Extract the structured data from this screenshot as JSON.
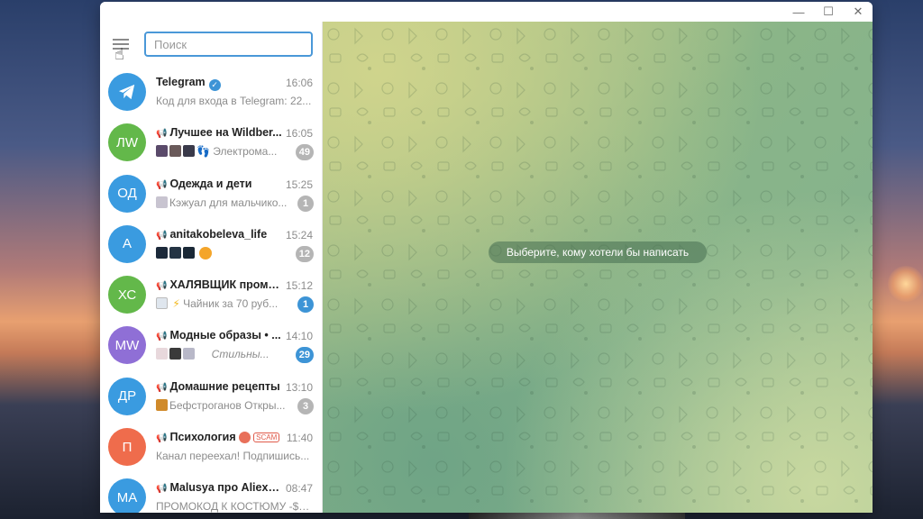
{
  "window": {
    "controls": {
      "minimize": "—",
      "maximize": "☐",
      "close": "✕"
    }
  },
  "sidebar": {
    "search": {
      "placeholder": "Поиск",
      "value": ""
    },
    "chats": [
      {
        "avatar_text": "",
        "avatar_color": "#3a9be0",
        "name": "Telegram",
        "verified": true,
        "time": "16:06",
        "preview": "Код для входа в Telegram: 22...",
        "badge": ""
      },
      {
        "avatar_text": "ЛW",
        "avatar_color": "#63b84a",
        "name": "Лучшее на Wildber...",
        "channel": true,
        "time": "16:05",
        "preview": "Электрома...",
        "badge": "49",
        "badge_style": "muted"
      },
      {
        "avatar_text": "ОД",
        "avatar_color": "#3a9be0",
        "name": "Одежда и дети",
        "channel": true,
        "time": "15:25",
        "preview": "Кэжуал для мальчико...",
        "badge": "1",
        "badge_style": "muted"
      },
      {
        "avatar_text": "А",
        "avatar_color": "#3a9be0",
        "name": "anitakobeleva_life",
        "channel": true,
        "time": "15:24",
        "preview": "",
        "badge": "12",
        "badge_style": "muted"
      },
      {
        "avatar_text": "ХС",
        "avatar_color": "#63b84a",
        "name": "ХАЛЯВЩИК промо...",
        "channel": true,
        "time": "15:12",
        "preview": "Чайник за 70 руб...",
        "badge": "1",
        "badge_style": "blue"
      },
      {
        "avatar_text": "MW",
        "avatar_color": "#8f6fd6",
        "name": "Модные образы • ...",
        "channel": true,
        "time": "14:10",
        "preview": "Стильны...",
        "badge": "29",
        "badge_style": "blue"
      },
      {
        "avatar_text": "ДР",
        "avatar_color": "#3a9be0",
        "name": "Домашние рецепты",
        "channel": true,
        "time": "13:10",
        "preview": "Бефстроганов  Откры...",
        "badge": "3",
        "badge_style": "muted"
      },
      {
        "avatar_text": "П",
        "avatar_color": "#ef6c4c",
        "name": "Психология",
        "channel": true,
        "scam": "SCAM",
        "time": "11:40",
        "preview": "Канал переехал! Подпишись...",
        "badge": ""
      },
      {
        "avatar_text": "MA",
        "avatar_color": "#3a9be0",
        "name": "Malusya про Aliexp...",
        "channel": true,
        "time": "08:47",
        "preview": "ПРОМОКОД К КОСТЮМУ -$3:...",
        "badge": ""
      }
    ]
  },
  "chat_area": {
    "placeholder_message": "Выберите, кому хотели бы написать"
  },
  "colors": {
    "accent": "#3d94d6",
    "muted_badge": "#b5b5b5"
  }
}
